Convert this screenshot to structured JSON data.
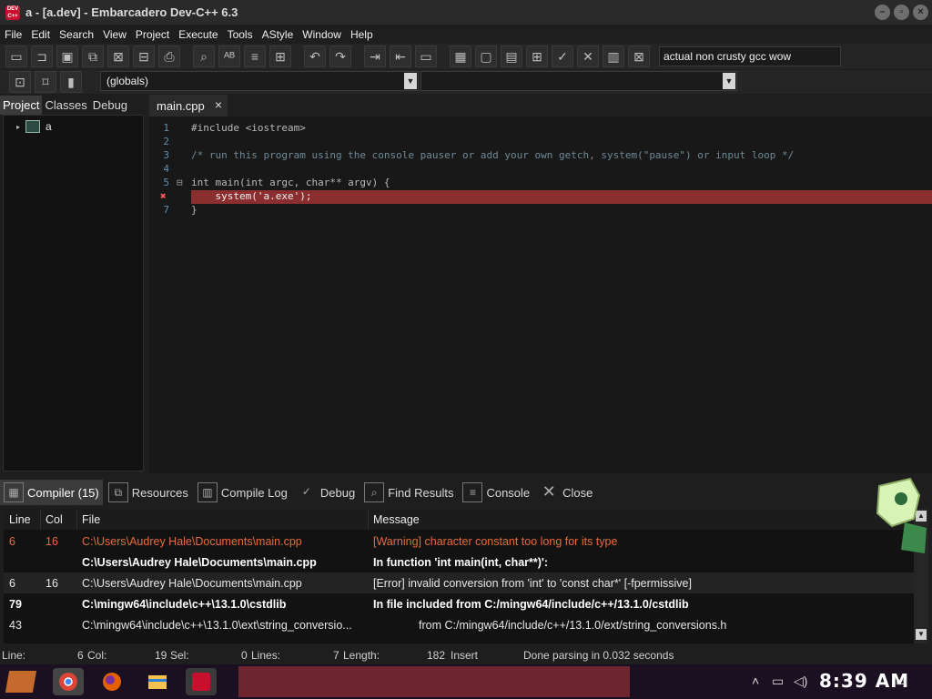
{
  "window": {
    "title": "a - [a.dev] - Embarcadero Dev-C++ 6.3",
    "controls": [
      "minimize",
      "maximize",
      "close"
    ]
  },
  "menu": [
    "File",
    "Edit",
    "Search",
    "View",
    "Project",
    "Execute",
    "Tools",
    "AStyle",
    "Window",
    "Help"
  ],
  "toolbar": {
    "compiler_field_value": "actual non crusty gcc wow",
    "scope_combo_value": "(globals)",
    "function_combo_value": ""
  },
  "left_panel": {
    "tabs": [
      "Project",
      "Classes",
      "Debug"
    ],
    "active_tab": "Project",
    "tree_root": "a"
  },
  "editor": {
    "tab_label": "main.cpp",
    "lines": [
      {
        "n": "1",
        "text": "#include <iostream>"
      },
      {
        "n": "2",
        "text": ""
      },
      {
        "n": "3",
        "text": "/* run this program using the console pauser or add your own getch, system(\"pause\") or input loop */"
      },
      {
        "n": "4",
        "text": ""
      },
      {
        "n": "5",
        "text": "int main(int argc, char** argv) {"
      },
      {
        "n": "",
        "text": "    system('a.exe');"
      },
      {
        "n": "7",
        "text": "}"
      }
    ]
  },
  "bottom_panel": {
    "tabs": [
      "Compiler (15)",
      "Resources",
      "Compile Log",
      "Debug",
      "Find Results",
      "Console",
      "Close"
    ],
    "active_tab": "Compiler (15)",
    "columns": [
      "Line",
      "Col",
      "File",
      "Message"
    ],
    "rows": [
      {
        "line": "6",
        "col": "16",
        "file": "C:\\Users\\Audrey Hale\\Documents\\main.cpp",
        "message": "[Warning] character constant too long for its type",
        "style": "warning"
      },
      {
        "line": "",
        "col": "",
        "file": "C:\\Users\\Audrey Hale\\Documents\\main.cpp",
        "message": "In function 'int main(int, char**)':",
        "style": "bold"
      },
      {
        "line": "6",
        "col": "16",
        "file": "C:\\Users\\Audrey Hale\\Documents\\main.cpp",
        "message": "[Error] invalid conversion from 'int' to 'const char*' [-fpermissive]",
        "style": "error"
      },
      {
        "line": "79",
        "col": "",
        "file": "C:\\mingw64\\include\\c++\\13.1.0\\cstdlib",
        "message": "In file included from C:/mingw64/include/c++/13.1.0/cstdlib",
        "style": "bold"
      },
      {
        "line": "43",
        "col": "",
        "file": "C:\\mingw64\\include\\c++\\13.1.0\\ext\\string_conversio...",
        "message": "from C:/mingw64/include/c++/13.1.0/ext/string_conversions.h",
        "style": "normal"
      }
    ]
  },
  "statusbar": {
    "line_label": "Line:",
    "line_value": "6",
    "col_label": "Col:",
    "col_value": "19",
    "sel_label": "Sel:",
    "sel_value": "0",
    "lines_label": "Lines:",
    "lines_value": "7",
    "length_label": "Length:",
    "length_value": "182",
    "mode": "Insert",
    "message": "Done parsing in 0.032 seconds"
  },
  "taskbar": {
    "clock": "8:39 AM",
    "apps": [
      "start-icon",
      "chrome-icon",
      "firefox-icon",
      "file-explorer-icon",
      "devcpp-icon"
    ]
  },
  "colors": {
    "error_line": "#8b2e30",
    "warning_text": "#e76b3c",
    "keyword": "#5d8fd6",
    "comment": "#6f8a96"
  }
}
